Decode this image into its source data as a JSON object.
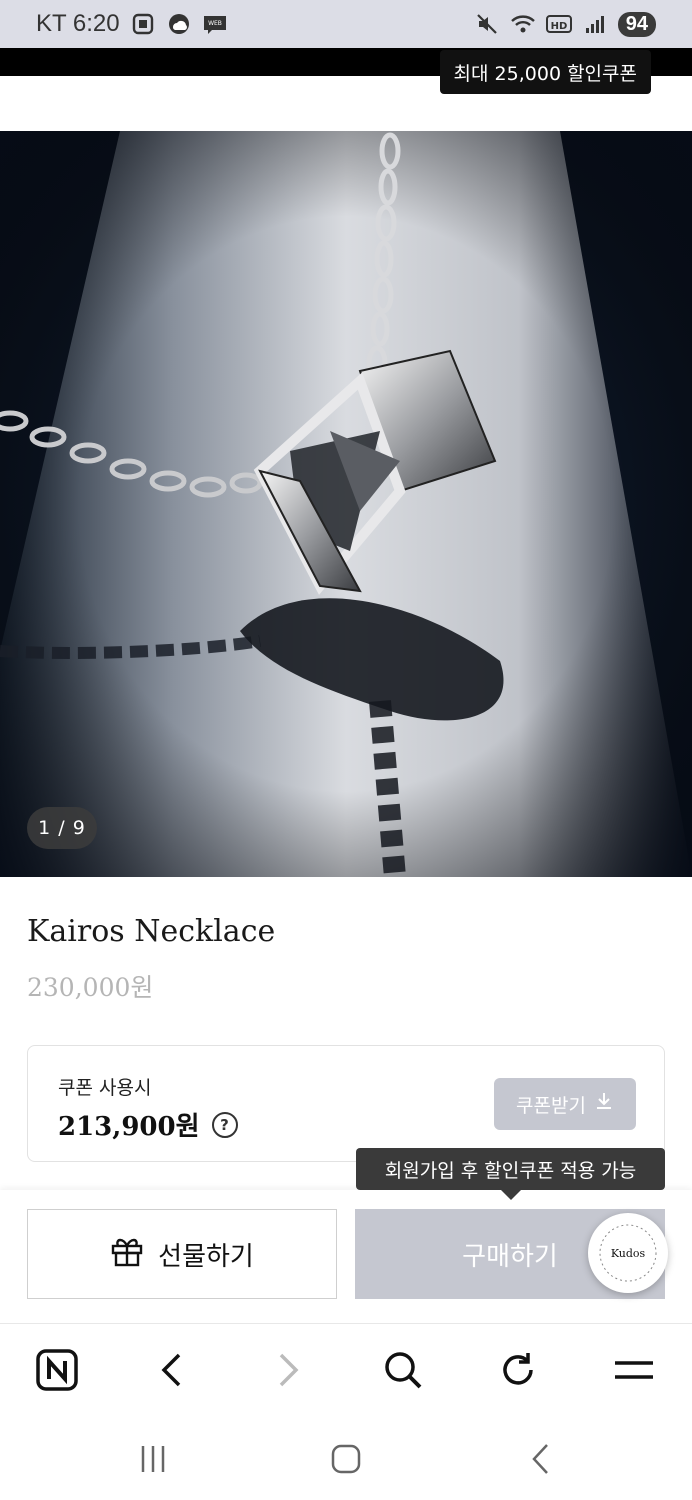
{
  "status_bar": {
    "carrier_time": "KT 6:20",
    "battery": "94",
    "icons": [
      "screenshot-icon",
      "weather-icon",
      "webtoon-icon",
      "mute-icon",
      "wifi-icon",
      "hd-icon",
      "signal-icon"
    ]
  },
  "promo": {
    "coupon_tooltip": "최대 25,000 할인쿠폰"
  },
  "gallery": {
    "page_indicator": "1 / 9"
  },
  "product": {
    "name": "Kairos Necklace",
    "price": "230,000원"
  },
  "coupon": {
    "label": "쿠폰 사용시",
    "discounted_price": "213,900원",
    "help_icon": "?",
    "download_button": "쿠폰받기"
  },
  "signup_tooltip": "회원가입 후 할인쿠폰 적용 가능",
  "actions": {
    "gift_button": "선물하기",
    "buy_button": "구매하기"
  },
  "kudos_badge": {
    "brand": "Kudos"
  },
  "browser_bar": {
    "icons": [
      "naver-home-icon",
      "back-icon",
      "forward-icon",
      "search-icon",
      "refresh-icon",
      "menu-icon"
    ]
  },
  "system_nav": {
    "icons": [
      "recent-apps-icon",
      "home-icon",
      "back-icon"
    ]
  },
  "colors": {
    "button_disabled": "#c5c7d0",
    "tooltip_dark": "#3a3a3a",
    "price_muted": "#b5b5b5"
  }
}
